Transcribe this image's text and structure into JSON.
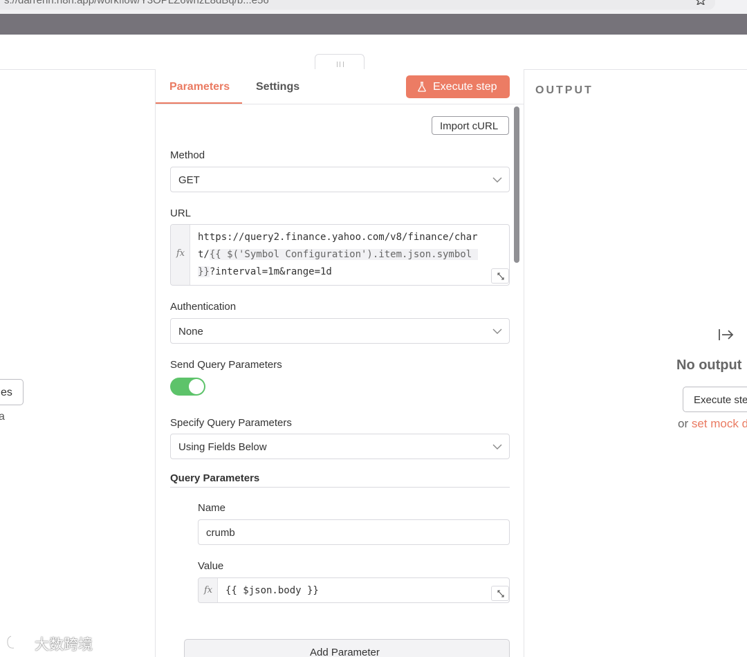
{
  "browser": {
    "address": "s://darrenh.n8n.app/workflow/Y3OPLZ6wnzL8dBq/b...e56"
  },
  "left_panel": {
    "button_fragment": "es",
    "text_fragment": "a"
  },
  "node": {
    "tabs": [
      {
        "label": "Parameters",
        "active": true
      },
      {
        "label": "Settings",
        "active": false
      }
    ],
    "execute_label": "Execute step",
    "import_label": "Import cURL",
    "method": {
      "label": "Method",
      "value": "GET"
    },
    "url": {
      "label": "URL",
      "fx": "fx",
      "line1": "https://query2.finance.yahoo.com/v8/finance/char",
      "line2_prefix": "t/",
      "line2_expr": "{{ $('Symbol Configuration').item.json.symbol ",
      "line3_expr": "}}",
      "line3_suffix": "?interval=1m&range=1d"
    },
    "authentication": {
      "label": "Authentication",
      "value": "None"
    },
    "send_query": {
      "label": "Send Query Parameters",
      "enabled": true
    },
    "specify_query": {
      "label": "Specify Query Parameters",
      "value": "Using Fields Below"
    },
    "query_parameters": {
      "title": "Query Parameters",
      "items": [
        {
          "name_label": "Name",
          "name": "crumb",
          "value_label": "Value",
          "fx": "fx",
          "value": "{{ $json.body }}"
        }
      ],
      "add_label": "Add Parameter"
    }
  },
  "output": {
    "title": "OUTPUT",
    "empty_title": "No output",
    "execute_label": "Execute step",
    "or_text": "or ",
    "mock_link": "set mock data"
  },
  "watermark": "大数跨境",
  "colors": {
    "accent": "#ec7c64",
    "toggle_on": "#5dc36a",
    "band": "#76737a"
  }
}
